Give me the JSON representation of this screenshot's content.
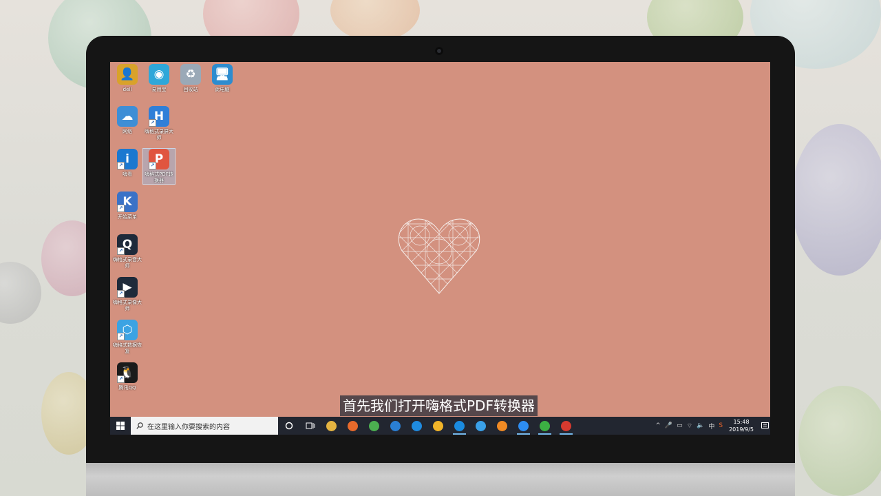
{
  "desktop_icons": [
    {
      "name": "user-folder-icon",
      "label": "dell",
      "bg": "#d9a22a",
      "glyph": "👤",
      "shortcut": false
    },
    {
      "name": "app-icon-1",
      "label": "易用宝",
      "bg": "#2ea7d9",
      "glyph": "◉",
      "shortcut": false
    },
    {
      "name": "recycle-bin-icon",
      "label": "回收站",
      "bg": "#9aa9b7",
      "glyph": "♻",
      "shortcut": false
    },
    {
      "name": "this-pc-icon",
      "label": "此电脑",
      "bg": "#2d8ccf",
      "glyph": "🖥",
      "shortcut": false
    },
    {
      "name": "network-icon",
      "label": "网络",
      "bg": "#3e8ed6",
      "glyph": "☁",
      "shortcut": false
    },
    {
      "name": "recorder-app-icon",
      "label": "嗨格式录屏大师",
      "bg": "#2f7fd8",
      "glyph": "H",
      "shortcut": true
    },
    {
      "name": "info-app-icon",
      "label": "嗨看",
      "bg": "#1b78d0",
      "glyph": "i",
      "shortcut": true
    },
    {
      "name": "pdf-converter-icon",
      "label": "嗨格式PDF转换器",
      "bg": "#e0553f",
      "glyph": "P",
      "shortcut": true,
      "selected": true
    },
    {
      "name": "app-icon-k",
      "label": "开始菜单",
      "bg": "#3a72c7",
      "glyph": "K",
      "shortcut": true
    },
    {
      "name": "app-icon-q",
      "label": "嗨格式录音大师",
      "bg": "#1e2a3a",
      "glyph": "Q",
      "shortcut": true
    },
    {
      "name": "video-app-icon",
      "label": "嗨格式录像大师",
      "bg": "#1e2a3a",
      "glyph": "▶",
      "shortcut": true
    },
    {
      "name": "cube-app-icon",
      "label": "嗨格式数据恢复",
      "bg": "#3ba3e3",
      "glyph": "⬡",
      "shortcut": true
    },
    {
      "name": "qq-icon",
      "label": "腾讯QQ",
      "bg": "#1b1b1b",
      "glyph": "🐧",
      "shortcut": true
    }
  ],
  "subtitle": "首先我们打开嗨格式PDF转换器",
  "taskbar": {
    "search_placeholder": "在这里输入你要搜索的内容",
    "apps": [
      {
        "name": "file-explorer-icon",
        "color": "#e3b341"
      },
      {
        "name": "firefox-icon",
        "color": "#e86a2b"
      },
      {
        "name": "chrome-icon",
        "color": "#4caf50"
      },
      {
        "name": "browser-q-icon",
        "color": "#2a7fd4"
      },
      {
        "name": "app-blue-icon",
        "color": "#1f8be0"
      },
      {
        "name": "chrome-2-icon",
        "color": "#f0b429"
      },
      {
        "name": "edge-icon",
        "color": "#1a8be0",
        "active": true
      },
      {
        "name": "ie-icon",
        "color": "#3aa0e8"
      },
      {
        "name": "orange-app-icon",
        "color": "#f08a24"
      },
      {
        "name": "mail-app-icon",
        "color": "#2d8cf0",
        "active": true
      },
      {
        "name": "wechat-icon",
        "color": "#3cb043",
        "active": true
      },
      {
        "name": "acrobat-icon",
        "color": "#d63a2f",
        "active": true
      }
    ],
    "tray": {
      "input_lang": "中",
      "time": "15:48",
      "date": "2019/9/5"
    }
  }
}
